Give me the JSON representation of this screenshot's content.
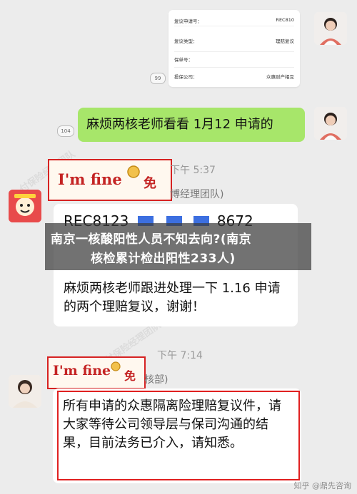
{
  "card": {
    "rows": [
      {
        "label": "复议申请号：",
        "value": "REC810"
      },
      {
        "label": "复议类型：",
        "value": "理赔复议"
      },
      {
        "label": "保单号：",
        "value": ""
      },
      {
        "label": "投保公司：",
        "value": "众惠财产相互"
      }
    ],
    "badge": "99"
  },
  "msg1": {
    "text": "麻烦两核老师看看 1月12 申请的",
    "badge": "104"
  },
  "fine1": {
    "text": "I'm fine",
    "time": "下午 5:37",
    "tag": "博经理团队)"
  },
  "msg2": {
    "ref": "REC8123",
    "ref_tail": "8672",
    "body": "麻烦两核老师跟进处理一下 1.16 申请的两个理赔复议，谢谢！"
  },
  "fine2": {
    "text": "I'm fine",
    "time": "下午 7:14",
    "tag": "核部)"
  },
  "msg3": {
    "text": "所有申请的众惠隔离险理赔复议件，请大家等待公司领导层与保司沟通的结果，目前法务已介入，请知悉。"
  },
  "overlay": {
    "line1": "南京一核酸阳性人员不知去向?(南京",
    "line2": "核检累计检出阳性233人)"
  },
  "watermark": {
    "text": "知乎 @鼎先咨询"
  },
  "colors": {
    "green": "#a7e66a",
    "red": "#e02020",
    "overlay": "#3c3c3c"
  }
}
